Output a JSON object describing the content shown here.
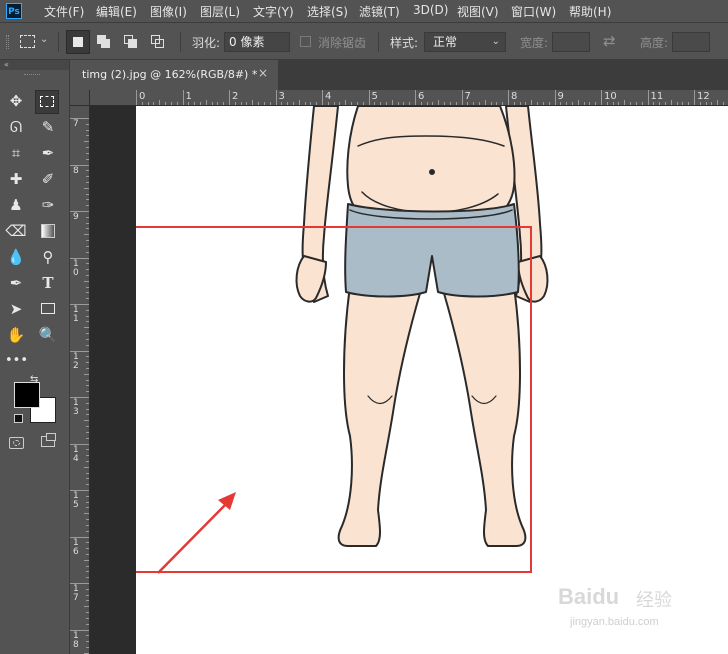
{
  "app": {
    "logo_text": "Ps"
  },
  "menu": [
    "文件(F)",
    "编辑(E)",
    "图像(I)",
    "图层(L)",
    "文字(Y)",
    "选择(S)",
    "滤镜(T)",
    "3D(D)",
    "视图(V)",
    "窗口(W)",
    "帮助(H)"
  ],
  "options": {
    "feather_label": "羽化:",
    "feather_value": "0 像素",
    "antialias_label": "消除锯齿",
    "style_label": "样式:",
    "style_value": "正常",
    "width_label": "宽度:",
    "height_label": "高度:"
  },
  "tab": {
    "title": "timg (2).jpg @ 162%(RGB/8#) *",
    "close": "×"
  },
  "ruler_h": [
    "0",
    "1",
    "2",
    "3",
    "4",
    "5",
    "6",
    "7",
    "8",
    "9",
    "10",
    "11",
    "12"
  ],
  "ruler_v": [
    "7",
    "8",
    "9",
    "1\n0",
    "1\n1",
    "1\n2",
    "1\n3",
    "1\n4",
    "1\n5",
    "1\n6",
    "1\n7",
    "1\n8"
  ],
  "watermark": {
    "brand": "Baidu",
    "suffix": "经验",
    "url": "jingyan.baidu.com"
  },
  "colors": {
    "selection_box": "#e53935",
    "arrow": "#e53935",
    "skin": "#fbe3d2",
    "shorts": "#a9bcc8"
  }
}
